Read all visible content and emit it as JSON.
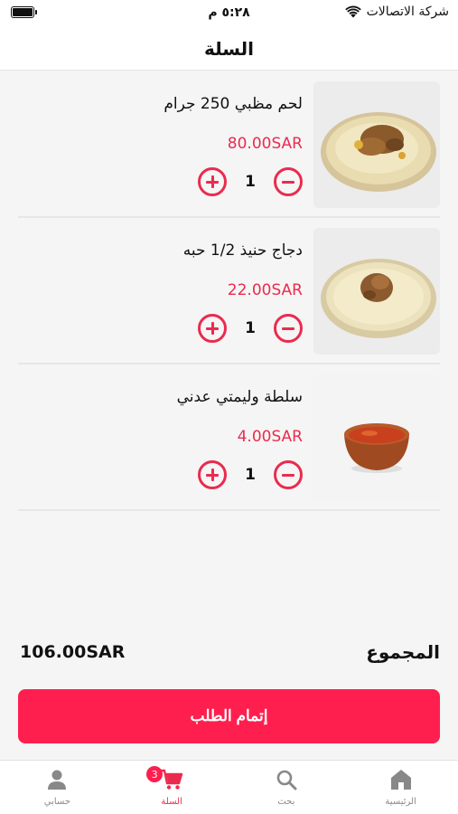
{
  "status_bar": {
    "carrier": "شركة الاتصالات",
    "time": "٥:٢٨ م"
  },
  "header": {
    "title": "السلة"
  },
  "cart": {
    "items": [
      {
        "name": "لحم مظبي 250 جرام",
        "price": "80.00SAR",
        "quantity": "1",
        "image_icon": "meat-rice-dish-image"
      },
      {
        "name": "دجاج حنيذ 1/2 حبه",
        "price": "22.00SAR",
        "quantity": "1",
        "image_icon": "chicken-rice-dish-image"
      },
      {
        "name": "سلطة وليمتي عدني",
        "price": "4.00SAR",
        "quantity": "1",
        "image_icon": "salad-bowl-image"
      }
    ]
  },
  "total": {
    "label": "المجموع",
    "amount": "106.00SAR"
  },
  "checkout": {
    "label": "إتمام الطلب"
  },
  "tab_bar": {
    "tabs": [
      {
        "label": "حسابي",
        "icon": "person-icon"
      },
      {
        "label": "السلة",
        "icon": "cart-icon",
        "badge": "3"
      },
      {
        "label": "بحث",
        "icon": "search-icon"
      },
      {
        "label": "الرئيسية",
        "icon": "home-icon"
      }
    ]
  },
  "colors": {
    "accent": "#ea2b4e",
    "checkout_button": "#ff1f4e",
    "tab_inactive": "#888888"
  }
}
